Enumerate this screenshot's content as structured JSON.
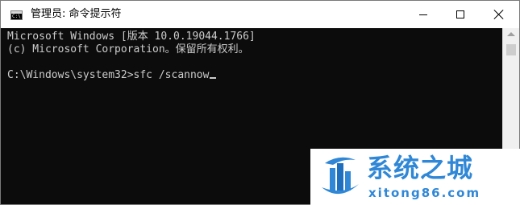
{
  "window": {
    "title": "管理员: 命令提示符",
    "icon_text": "C:\\"
  },
  "controls": {
    "minimize": "minimize-icon",
    "maximize": "maximize-icon",
    "close": "close-icon"
  },
  "console": {
    "lines": [
      "Microsoft Windows [版本 10.0.19044.1766]",
      "(c) Microsoft Corporation。保留所有权利。",
      "",
      "C:\\Windows\\system32>sfc /scannow"
    ]
  },
  "watermark": {
    "chinese": "系统之城",
    "url": "xitong86.com"
  },
  "colors": {
    "console_bg": "#0c0c0c",
    "console_text": "#cccccc",
    "titlebar_bg": "#ffffff",
    "watermark_blue": "#2f87d6"
  }
}
